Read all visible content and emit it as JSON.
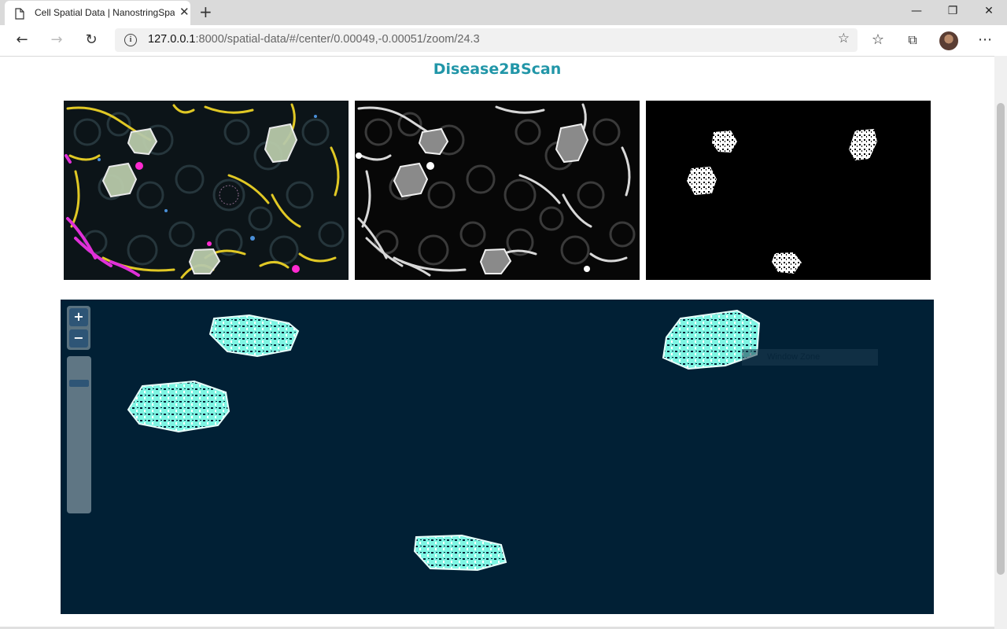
{
  "browser": {
    "tab_title": "Cell Spatial Data | NanostringSpatial",
    "url_host": "127.0.0.1",
    "url_rest": ":8000/spatial-data/#/center/0.00049,-0.00051/zoom/24.3",
    "icons": [
      "page-icon",
      "close-icon",
      "new-tab-icon",
      "back-icon",
      "forward-icon",
      "refresh-icon",
      "site-info-icon",
      "favorite-star-icon",
      "favorites-list-icon",
      "collections-icon",
      "profile-avatar",
      "more-menu-icon"
    ]
  },
  "page": {
    "title": "Disease2BScan"
  },
  "viewer": {
    "zoom_in_label": "+",
    "zoom_out_label": "−",
    "tooltip": "Window Zone",
    "zoom_level": 24.3,
    "slider_position": 0.15,
    "background": "#012035",
    "roi_color": "#7ff5e3"
  },
  "panels": [
    {
      "name": "fluorescence-composite"
    },
    {
      "name": "grayscale-channel"
    },
    {
      "name": "segmentation-mask"
    }
  ]
}
